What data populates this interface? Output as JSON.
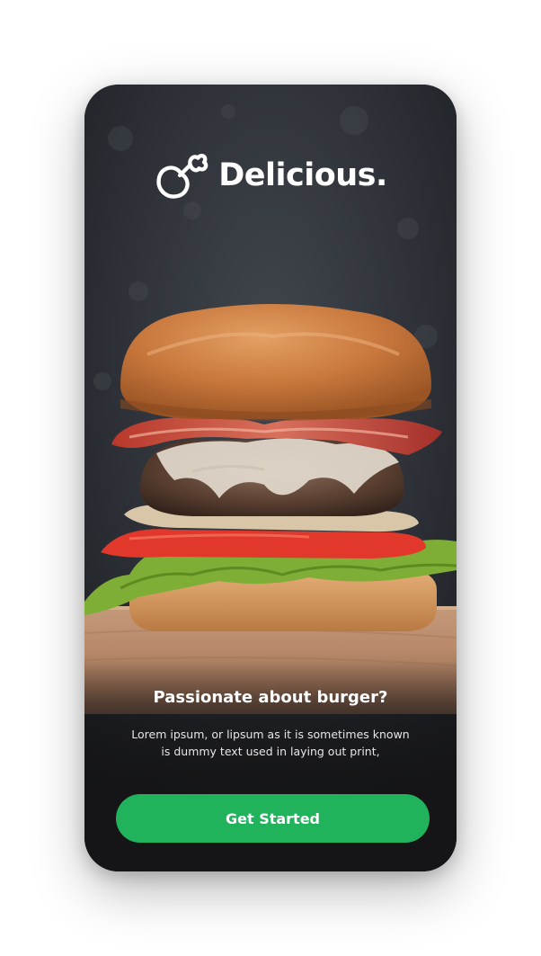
{
  "brand": {
    "name": "Delicious.",
    "icon": "chicken-drumstick-icon"
  },
  "hero": {
    "image": "burger-photo",
    "headline": "Passionate about burger?",
    "description_line1": "Lorem ipsum, or lipsum as it is sometimes known",
    "description_line2": "is dummy text used in laying out print,"
  },
  "cta": {
    "label": "Get Started",
    "color": "#21b25c"
  }
}
